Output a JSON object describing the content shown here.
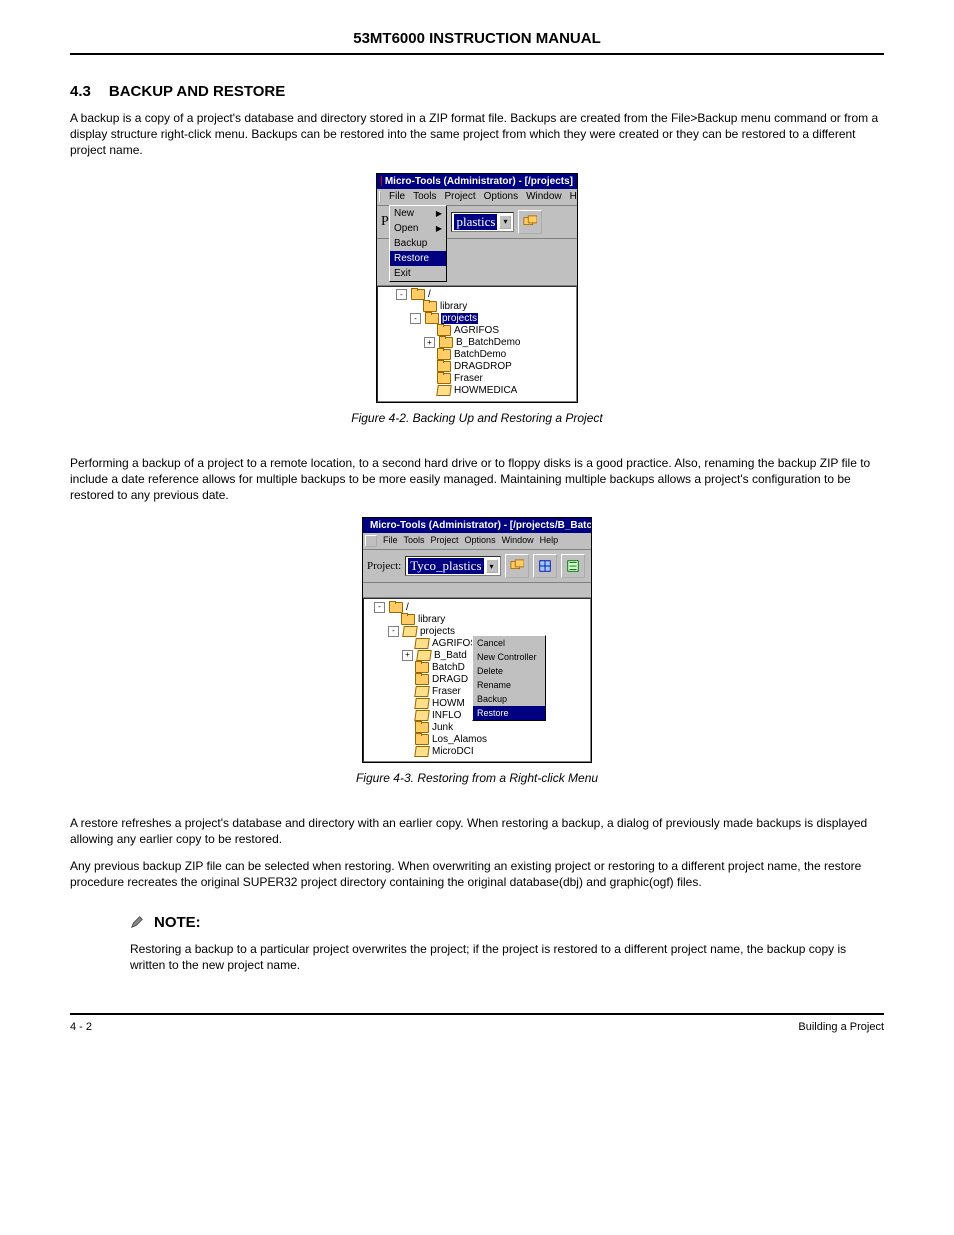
{
  "header": {
    "title": "53MT6000 INSTRUCTION MANUAL"
  },
  "section": {
    "num": "4.3",
    "title": "BACKUP AND RESTORE"
  },
  "intro_text": "A backup is a copy of a project's database and directory stored in a ZIP format file. Backups are created from the File>Backup menu command or from a display structure right-click menu. Backups can be restored into the same project from which they were created or they can be restored to a different project name.",
  "fig1": {
    "caption": "Figure 4-2. Backing Up and Restoring a Project",
    "titlebar": "Micro-Tools (Administrator) - [/projects]",
    "menubar": [
      "File",
      "Tools",
      "Project",
      "Options",
      "Window",
      "H"
    ],
    "file_menu": [
      {
        "label": "New",
        "arrow": true,
        "sel": false
      },
      {
        "label": "Open",
        "arrow": true,
        "sel": false
      },
      {
        "label": "Backup",
        "arrow": false,
        "sel": false
      },
      {
        "label": "Restore",
        "arrow": false,
        "sel": true
      },
      {
        "label": "Exit",
        "arrow": false,
        "sel": false
      }
    ],
    "project_label": "Pr",
    "combo_value": "plastics",
    "tree": [
      {
        "indent": 1,
        "exp": "-",
        "folder": "closed",
        "label": "/",
        "sel": false
      },
      {
        "indent": 2,
        "exp": "",
        "folder": "closed",
        "label": "library",
        "sel": false
      },
      {
        "indent": 2,
        "exp": "-",
        "folder": "closed",
        "label": "projects",
        "sel": true
      },
      {
        "indent": 3,
        "exp": "",
        "folder": "closed",
        "label": "AGRIFOS",
        "sel": false
      },
      {
        "indent": 3,
        "exp": "+",
        "folder": "closed",
        "label": "B_BatchDemo",
        "sel": false
      },
      {
        "indent": 3,
        "exp": "",
        "folder": "closed",
        "label": "BatchDemo",
        "sel": false
      },
      {
        "indent": 3,
        "exp": "",
        "folder": "closed",
        "label": "DRAGDROP",
        "sel": false
      },
      {
        "indent": 3,
        "exp": "",
        "folder": "closed",
        "label": "Fraser",
        "sel": false
      },
      {
        "indent": 3,
        "exp": "",
        "folder": "open",
        "label": "HOWMEDICA",
        "sel": false
      }
    ]
  },
  "mid_text": "Performing a backup of a project to a remote location, to a second hard drive or to floppy disks is a good practice. Also, renaming the backup ZIP file to include a date reference allows for multiple backups to be more easily managed. Maintaining multiple backups allows a project's configuration to be restored to any previous date.",
  "fig2": {
    "caption": "Figure 4-3. Restoring from a Right-click Menu",
    "titlebar": "Micro-Tools (Administrator) - [/projects/B_BatchDe",
    "menubar": [
      "File",
      "Tools",
      "Project",
      "Options",
      "Window",
      "Help"
    ],
    "project_label": "Project:",
    "combo_value": "Tyco_plastics",
    "tree": [
      {
        "indent": 0,
        "exp": "-",
        "folder": "closed",
        "label": "/",
        "sel": false
      },
      {
        "indent": 1,
        "exp": "",
        "folder": "closed",
        "label": "library",
        "sel": false
      },
      {
        "indent": 1,
        "exp": "-",
        "folder": "open",
        "label": "projects",
        "sel": false
      },
      {
        "indent": 2,
        "exp": "",
        "folder": "open",
        "label": "AGRIFOS",
        "sel": false
      },
      {
        "indent": 2,
        "exp": "+",
        "folder": "open",
        "label": "B_Batd",
        "sel": false
      },
      {
        "indent": 2,
        "exp": "",
        "folder": "closed",
        "label": "BatchD",
        "sel": false
      },
      {
        "indent": 2,
        "exp": "",
        "folder": "closed",
        "label": "DRAGD",
        "sel": false
      },
      {
        "indent": 2,
        "exp": "",
        "folder": "open",
        "label": "Fraser",
        "sel": false
      },
      {
        "indent": 2,
        "exp": "",
        "folder": "open",
        "label": "HOWM",
        "sel": false
      },
      {
        "indent": 2,
        "exp": "",
        "folder": "open",
        "label": "INFLO",
        "sel": false
      },
      {
        "indent": 2,
        "exp": "",
        "folder": "closed",
        "label": "Junk",
        "sel": false
      },
      {
        "indent": 2,
        "exp": "",
        "folder": "closed",
        "label": "Los_Alamos",
        "sel": false
      },
      {
        "indent": 2,
        "exp": "",
        "folder": "open",
        "label": "MicroDCI",
        "sel": false
      }
    ],
    "context_menu": [
      {
        "label": "Cancel",
        "sel": false
      },
      {
        "label": "New Controller",
        "sel": false
      },
      {
        "label": "Delete",
        "sel": false
      },
      {
        "label": "Rename",
        "sel": false
      },
      {
        "label": "Backup",
        "sel": false
      },
      {
        "label": "Restore",
        "sel": true
      }
    ]
  },
  "para2": "A restore refreshes a project's database and directory with an earlier copy. When restoring a backup, a dialog of previously made backups is displayed allowing any earlier copy to be restored.",
  "para3": "Any previous backup ZIP file can be selected when restoring. When overwriting an existing project or restoring to a different project name, the restore procedure recreates the original SUPER32 project directory containing the original database(dbj) and graphic(ogf) files.",
  "note": {
    "label": "NOTE:",
    "text": "Restoring a backup to a particular project overwrites the project; if the project is restored to a different project name, the backup copy is written to the new project name."
  },
  "footer": {
    "left": "4 - 2",
    "right": "Building a Project"
  }
}
